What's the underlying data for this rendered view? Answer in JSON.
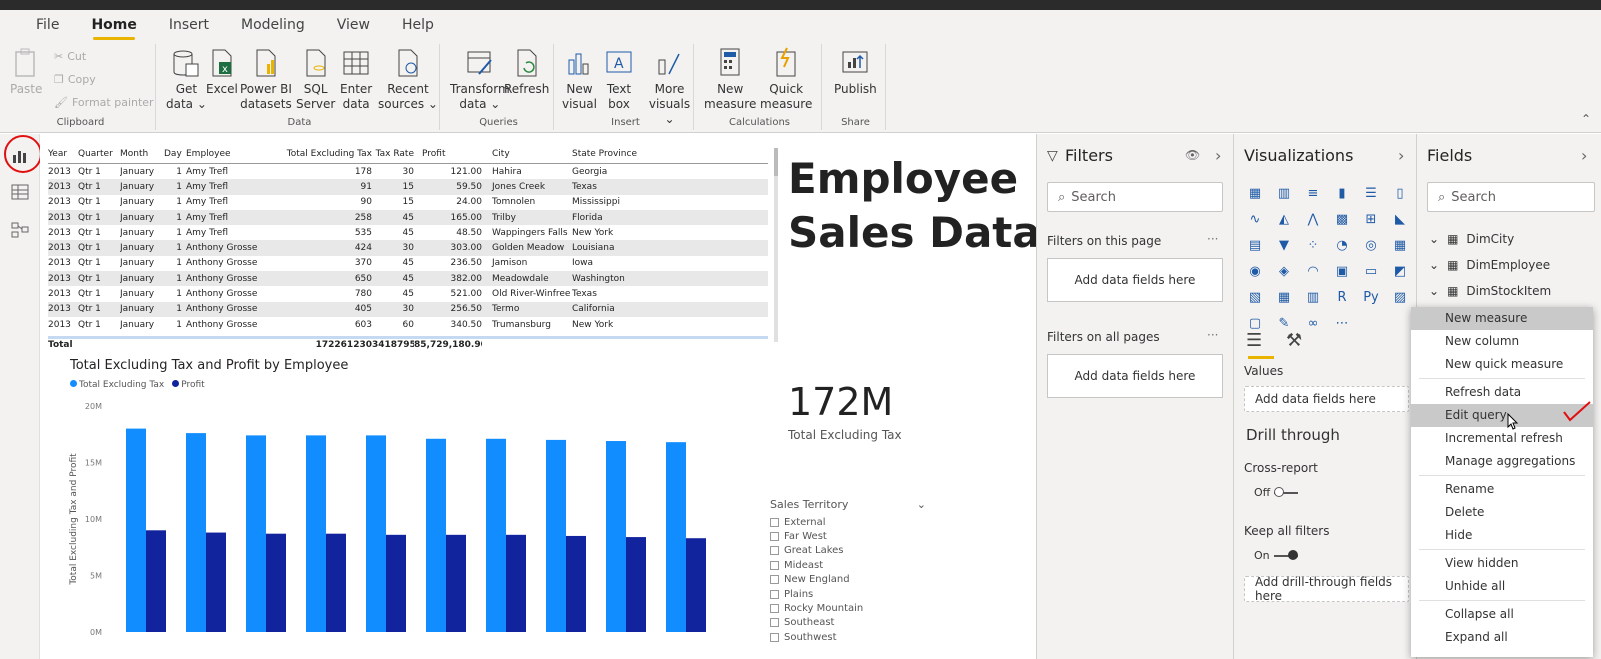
{
  "menu": {
    "items": [
      "File",
      "Home",
      "Insert",
      "Modeling",
      "View",
      "Help"
    ],
    "active": "Home"
  },
  "ribbon": {
    "clipboard": {
      "paste": "Paste",
      "cut": "Cut",
      "copy": "Copy",
      "format_painter": "Format painter",
      "label": "Clipboard"
    },
    "data": {
      "get_data": [
        "Get",
        "data ⌄"
      ],
      "excel": [
        "Excel",
        ""
      ],
      "powerbi": [
        "Power BI",
        "datasets"
      ],
      "sql": [
        "SQL",
        "Server"
      ],
      "enter": [
        "Enter",
        "data"
      ],
      "recent": [
        "Recent",
        "sources ⌄"
      ],
      "label": "Data"
    },
    "queries": {
      "transform": [
        "Transform",
        "data ⌄"
      ],
      "refresh": [
        "Refresh",
        ""
      ],
      "label": "Queries"
    },
    "insert": {
      "new_visual": [
        "New",
        "visual"
      ],
      "text_box": [
        "Text",
        "box"
      ],
      "more_visuals": [
        "More",
        "visuals ⌄"
      ],
      "label": "Insert"
    },
    "calculations": {
      "new_measure": [
        "New",
        "measure"
      ],
      "quick_measure": [
        "Quick",
        "measure"
      ],
      "label": "Calculations"
    },
    "share": {
      "publish": "Publish",
      "label": "Share"
    }
  },
  "table": {
    "headers": [
      "Year",
      "Quarter",
      "Month",
      "Day",
      "Employee",
      "Total Excluding Tax",
      "Tax Rate",
      "Profit",
      "City",
      "State Province"
    ],
    "rows": [
      [
        "2013",
        "Qtr 1",
        "January",
        "1",
        "Amy Trefl",
        "178",
        "30",
        "121.00",
        "Hahira",
        "Georgia"
      ],
      [
        "2013",
        "Qtr 1",
        "January",
        "1",
        "Amy Trefl",
        "91",
        "15",
        "59.50",
        "Jones Creek",
        "Texas"
      ],
      [
        "2013",
        "Qtr 1",
        "January",
        "1",
        "Amy Trefl",
        "90",
        "15",
        "24.00",
        "Tomnolen",
        "Mississippi"
      ],
      [
        "2013",
        "Qtr 1",
        "January",
        "1",
        "Amy Trefl",
        "258",
        "45",
        "165.00",
        "Trilby",
        "Florida"
      ],
      [
        "2013",
        "Qtr 1",
        "January",
        "1",
        "Amy Trefl",
        "535",
        "45",
        "48.50",
        "Wappingers Falls",
        "New York"
      ],
      [
        "2013",
        "Qtr 1",
        "January",
        "1",
        "Anthony Grosse",
        "424",
        "30",
        "303.00",
        "Golden Meadow",
        "Louisiana"
      ],
      [
        "2013",
        "Qtr 1",
        "January",
        "1",
        "Anthony Grosse",
        "370",
        "45",
        "236.50",
        "Jamison",
        "Iowa"
      ],
      [
        "2013",
        "Qtr 1",
        "January",
        "1",
        "Anthony Grosse",
        "650",
        "45",
        "382.00",
        "Meadowdale",
        "Washington"
      ],
      [
        "2013",
        "Qtr 1",
        "January",
        "1",
        "Anthony Grosse",
        "780",
        "45",
        "521.00",
        "Old River-Winfree",
        "Texas"
      ],
      [
        "2013",
        "Qtr 1",
        "January",
        "1",
        "Anthony Grosse",
        "405",
        "30",
        "256.50",
        "Termo",
        "California"
      ],
      [
        "2013",
        "Qtr 1",
        "January",
        "1",
        "Anthony Grosse",
        "603",
        "60",
        "340.50",
        "Trumansburg",
        "New York"
      ]
    ],
    "total": {
      "label": "Total",
      "total_excl_tax": "172261230",
      "tax_rate": "3418795",
      "profit": "85,729,180.90"
    }
  },
  "chart_data": {
    "type": "bar",
    "title": "Total Excluding Tax and Profit by Employee",
    "ylabel": "Total Excluding Tax and Profit",
    "yticks": [
      "0M",
      "5M",
      "10M",
      "15M",
      "20M"
    ],
    "ylim": [
      0,
      20
    ],
    "series": [
      {
        "name": "Total Excluding Tax",
        "color": "#118dff",
        "values": [
          18.0,
          17.6,
          17.4,
          17.4,
          17.4,
          17.1,
          17.1,
          17.0,
          16.9,
          16.8
        ]
      },
      {
        "name": "Profit",
        "color": "#12239e",
        "values": [
          9.0,
          8.8,
          8.7,
          8.7,
          8.6,
          8.6,
          8.6,
          8.5,
          8.4,
          8.3
        ]
      }
    ]
  },
  "title_card": {
    "line1": "Employee",
    "line2": "Sales Data"
  },
  "kpi": {
    "value": "172M",
    "label": "Total Excluding Tax"
  },
  "slicer": {
    "title": "Sales Territory",
    "items": [
      "External",
      "Far West",
      "Great Lakes",
      "Mideast",
      "New England",
      "Plains",
      "Rocky Mountain",
      "Southeast",
      "Southwest"
    ]
  },
  "filters": {
    "title": "Filters",
    "search": "Search",
    "this_page": "Filters on this page",
    "all_pages": "Filters on all pages",
    "add": "Add data fields here",
    "more": "···"
  },
  "visualizations": {
    "title": "Visualizations",
    "values_label": "Values",
    "add_fields": "Add data fields here",
    "drill_title": "Drill through",
    "cross_report": "Cross-report",
    "off": "Off",
    "keep_filters": "Keep all filters",
    "on": "On",
    "add_drill": "Add drill-through fields here",
    "icons": [
      "▦",
      "▥",
      "≡",
      "▮",
      "☰",
      "▯",
      "∿",
      "◭",
      "⋀",
      "▩",
      "⊞",
      "◣",
      "▤",
      "▼",
      "⁘",
      "◔",
      "◎",
      "▦",
      "◉",
      "◈",
      "◠",
      "▣",
      "▭",
      "◩",
      "▧",
      "▦",
      "▥",
      "R",
      "Py",
      "▨",
      "▢",
      "✎",
      "∞",
      "⋯"
    ]
  },
  "fields": {
    "title": "Fields",
    "search": "Search",
    "tables": [
      "DimCity",
      "DimEmployee",
      "DimStockItem"
    ]
  },
  "context_menu": {
    "items": [
      "New measure",
      "New column",
      "New quick measure",
      "Refresh data",
      "Edit query",
      "Incremental refresh",
      "Manage aggregations",
      "Rename",
      "Delete",
      "Hide",
      "View hidden",
      "Unhide all",
      "Collapse all",
      "Expand all"
    ]
  },
  "colors": {
    "accent": "#e8b400",
    "bar1": "#118dff",
    "bar2": "#12239e",
    "annotation": "#e01010"
  }
}
